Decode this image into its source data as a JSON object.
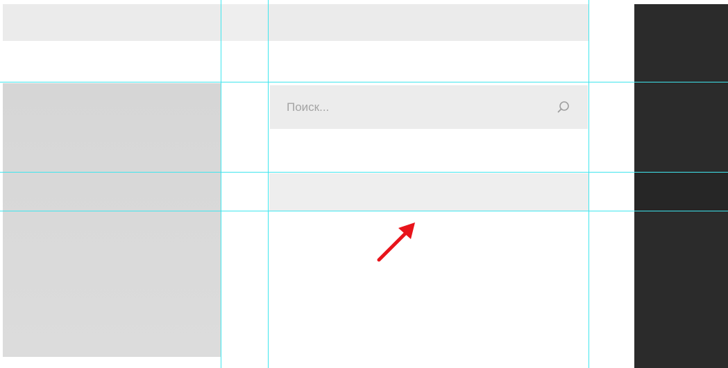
{
  "search": {
    "placeholder": "Поиск..."
  },
  "icons": {
    "search": "search-icon",
    "annotation": "arrow-icon"
  },
  "colors": {
    "guide_lines": "#3ee6ee",
    "annotation_arrow": "#e8141b",
    "dark_panel": "#2b2b2b",
    "placeholder_block": "#d6d6d6",
    "search_background": "#ececec"
  }
}
